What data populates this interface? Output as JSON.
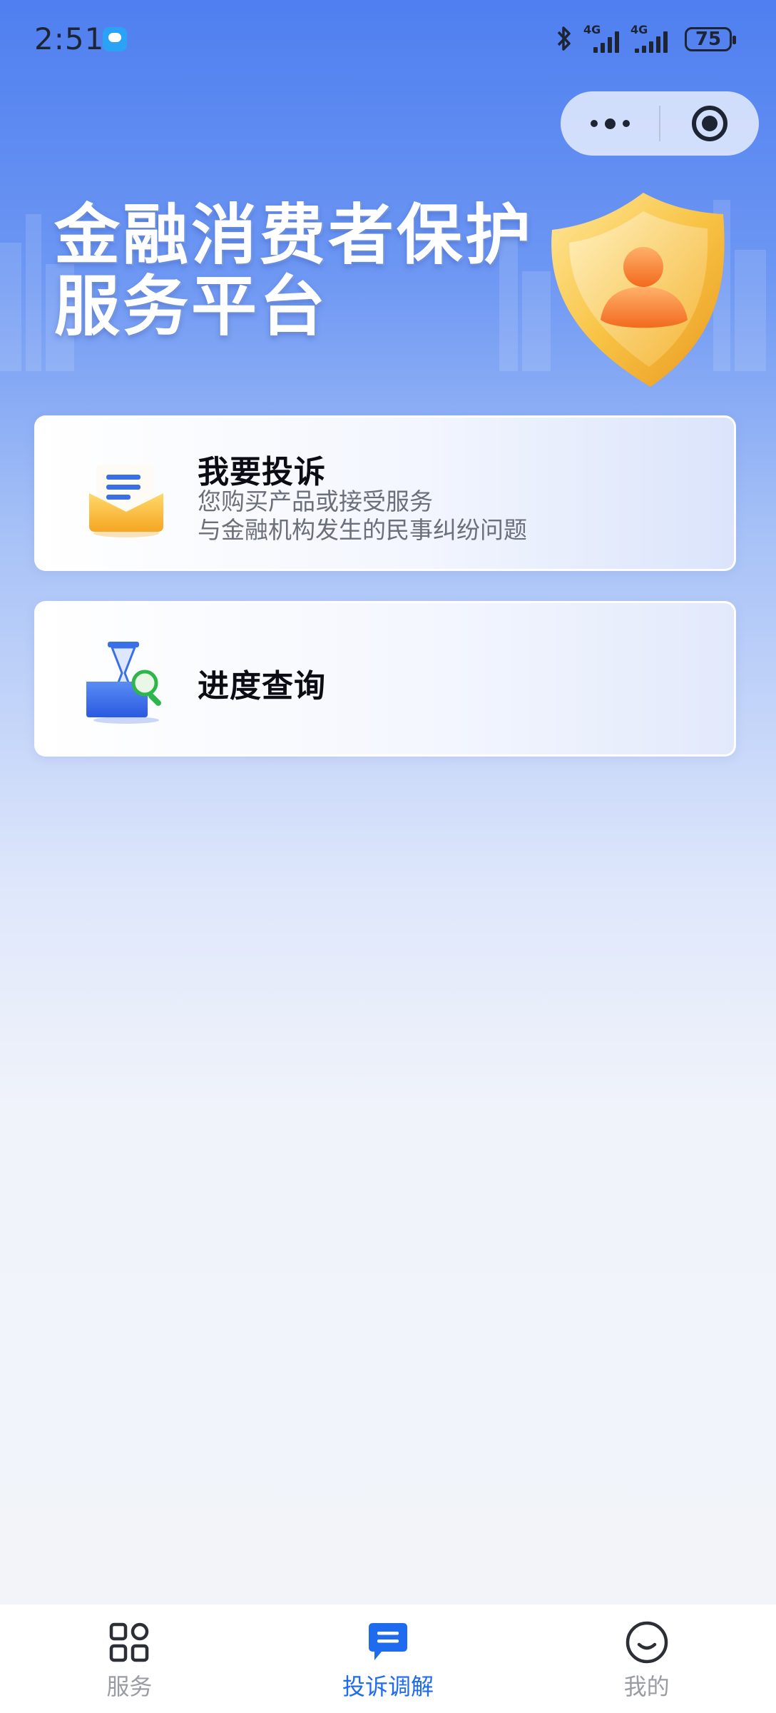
{
  "status_bar": {
    "time": "2:51",
    "signal_1_label": "4G",
    "signal_2_label": "4G",
    "battery": "75"
  },
  "capsule": {
    "more_icon": "more-dots-icon",
    "close_icon": "target-circle-icon"
  },
  "hero": {
    "title_line1": "金融消费者保护",
    "title_line2": "服务平台",
    "emblem_icon": "shield-person-icon"
  },
  "cards": [
    {
      "title": "我要投诉",
      "desc_line1": "您购买产品或接受服务",
      "desc_line2": "与金融机构发生的民事纠纷问题",
      "icon": "envelope-document-icon"
    },
    {
      "title": "进度查询",
      "icon": "hourglass-search-icon"
    }
  ],
  "tabbar": {
    "items": [
      {
        "label": "服务",
        "icon": "grid-icon",
        "active": false
      },
      {
        "label": "投诉调解",
        "icon": "message-icon",
        "active": true
      },
      {
        "label": "我的",
        "icon": "smile-icon",
        "active": false
      }
    ]
  },
  "colors": {
    "accent": "#1e6bf0",
    "tab_inactive": "#999ca3",
    "header_blue": "#4f7ff0"
  }
}
